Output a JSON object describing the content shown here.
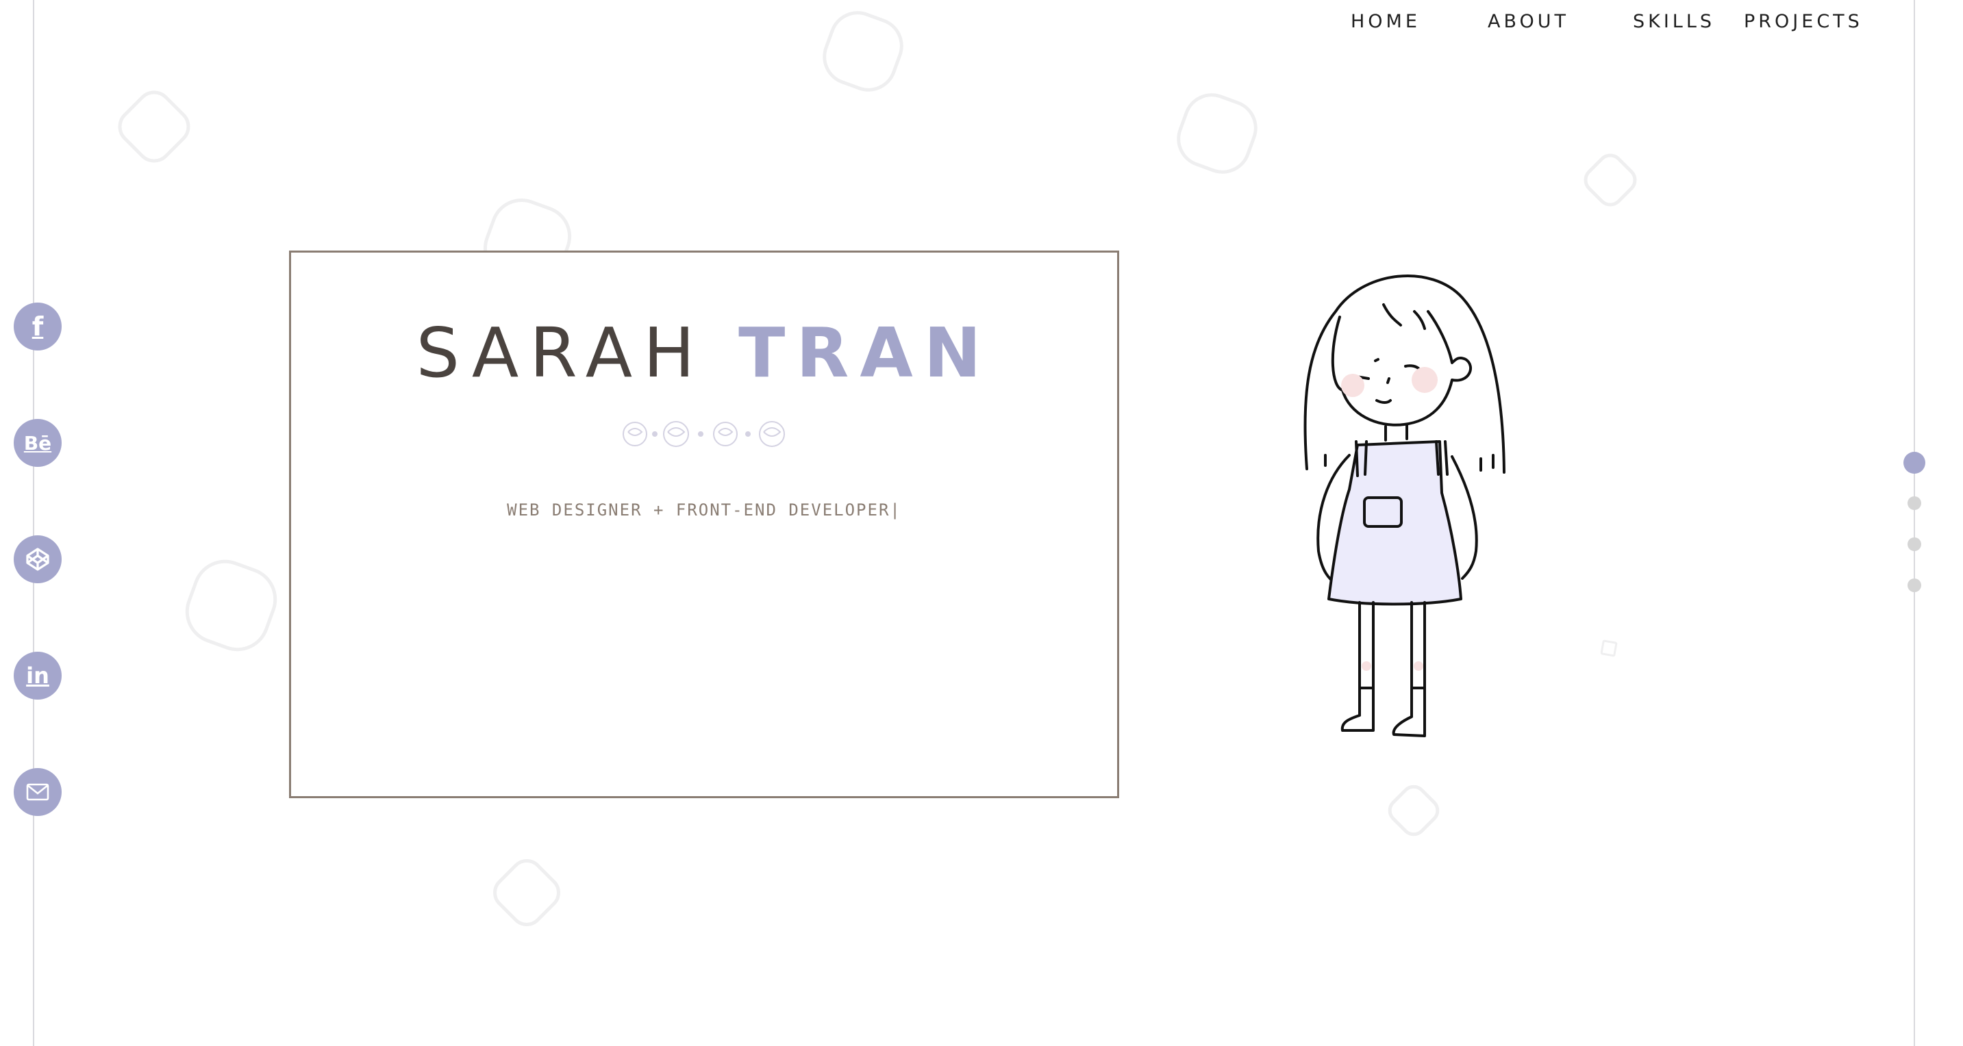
{
  "nav": {
    "items": [
      {
        "label": "HOME"
      },
      {
        "label": "ABOUT"
      },
      {
        "label": "SKILLS"
      },
      {
        "label": "PROJECTS"
      }
    ]
  },
  "social": {
    "items": [
      {
        "name": "facebook",
        "glyph": "f"
      },
      {
        "name": "behance",
        "glyph": "Bē"
      },
      {
        "name": "codepen",
        "glyph": "codepen"
      },
      {
        "name": "linkedin",
        "glyph": "in"
      },
      {
        "name": "email",
        "glyph": "envelope"
      }
    ]
  },
  "hero": {
    "first_name": "SARAH",
    "last_name": "TRAN",
    "subtitle": "WEB DESIGNER + FRONT-END DEVELOPER|"
  },
  "colors": {
    "accent": "#a3a5ca",
    "name_dark": "#4a433f",
    "border": "#8a7d73"
  },
  "pagination": {
    "count": 4,
    "active_index": 0
  }
}
